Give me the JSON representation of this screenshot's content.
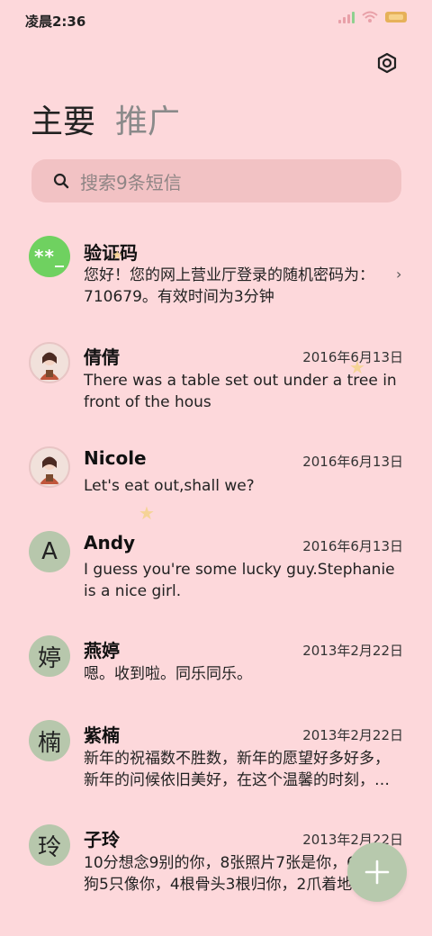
{
  "status": {
    "time": "凌晨2:36"
  },
  "tabs": [
    {
      "label": "主要",
      "active": true
    },
    {
      "label": "推广",
      "active": false
    }
  ],
  "search": {
    "placeholder": "搜索9条短信"
  },
  "colors": {
    "background": "#fdd8db",
    "search": "#f2c2c4",
    "avatar_green": "#6fd160",
    "avatar_sage": "#b7c7ac",
    "fab": "#b7c9ad"
  },
  "conversations": [
    {
      "name": "验证码",
      "avatar": "**_",
      "date": "",
      "preview": "您好！您的网上营业厅登录的随机密码为：710679。有效时间为3分钟"
    },
    {
      "name": "倩倩",
      "avatar": "photo-avatar",
      "date": "2016年6月13日",
      "preview": "There was a table set out under a tree in front of the hous"
    },
    {
      "name": "Nicole",
      "avatar": "photo-avatar",
      "date": "2016年6月13日",
      "preview": "Let's eat out,shall we?"
    },
    {
      "name": "Andy",
      "avatar": "A",
      "date": "2016年6月13日",
      "preview": "I guess you're some lucky guy.Stephanie is a nice girl."
    },
    {
      "name": "燕婷",
      "avatar": "婷",
      "date": "2013年2月22日",
      "preview": "嗯。收到啦。同乐同乐。"
    },
    {
      "name": "紫楠",
      "avatar": "楠",
      "date": "2013年2月22日",
      "preview": "新年的祝福数不胜数，新年的愿望好多好多，新年的问候依旧美好，在这个温馨的时刻，…"
    },
    {
      "name": "子玲",
      "avatar": "玲",
      "date": "2013年2月22日",
      "preview": "10分想念9别的你，8张照片7张是你，6只小狗5只像你，4根骨头3根归你，2爪着地"
    }
  ]
}
